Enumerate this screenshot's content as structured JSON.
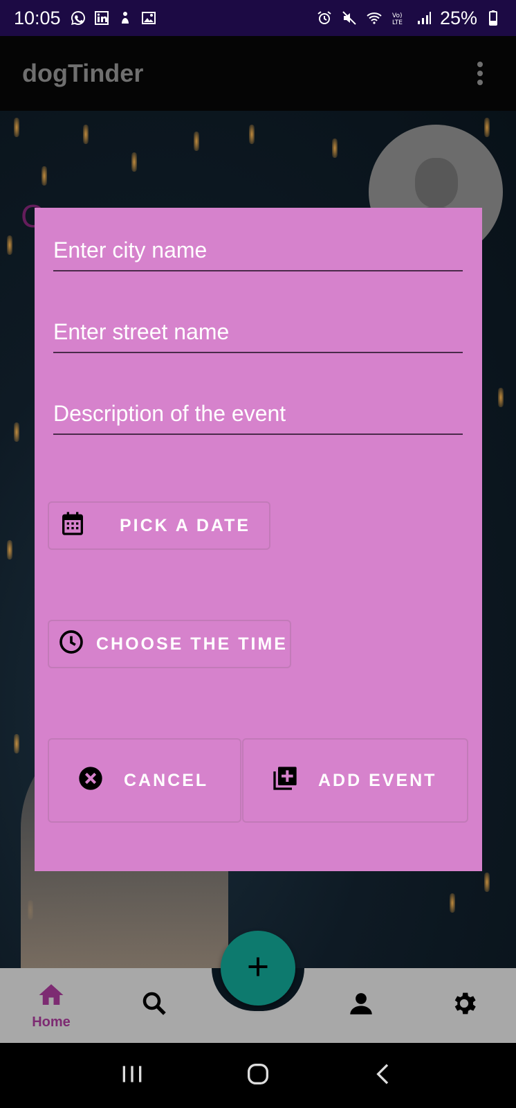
{
  "status_bar": {
    "time": "10:05",
    "battery": "25%",
    "left_icons": [
      "whatsapp-icon",
      "linkedin-icon",
      "notification-icon",
      "gallery-icon"
    ],
    "right_icons": [
      "alarm-icon",
      "mute-icon",
      "wifi-icon",
      "volte-icon",
      "signal-icon",
      "battery-icon"
    ]
  },
  "app_bar": {
    "title": "dogTinder",
    "menu_icon": "more-vert-icon"
  },
  "dialog": {
    "city_placeholder": "Enter city name",
    "street_placeholder": "Enter street name",
    "description_placeholder": "Description of the event",
    "pick_date_label": "PICK A DATE",
    "choose_time_label": "CHOOSE THE TIME",
    "cancel_label": "CANCEL",
    "add_event_label": "ADD EVENT"
  },
  "bottom_nav": {
    "items": [
      {
        "label": "Home",
        "icon": "home-icon",
        "active": true
      },
      {
        "label": "",
        "icon": "search-icon"
      },
      {
        "label": "",
        "icon": "person-icon"
      },
      {
        "label": "",
        "icon": "settings-icon"
      }
    ],
    "fab_icon": "plus-icon"
  },
  "colors": {
    "dialog_bg": "#d682cc",
    "fab": "#0d7a6e",
    "status_bar": "#1c0a44",
    "active_nav": "#7d2b72"
  }
}
